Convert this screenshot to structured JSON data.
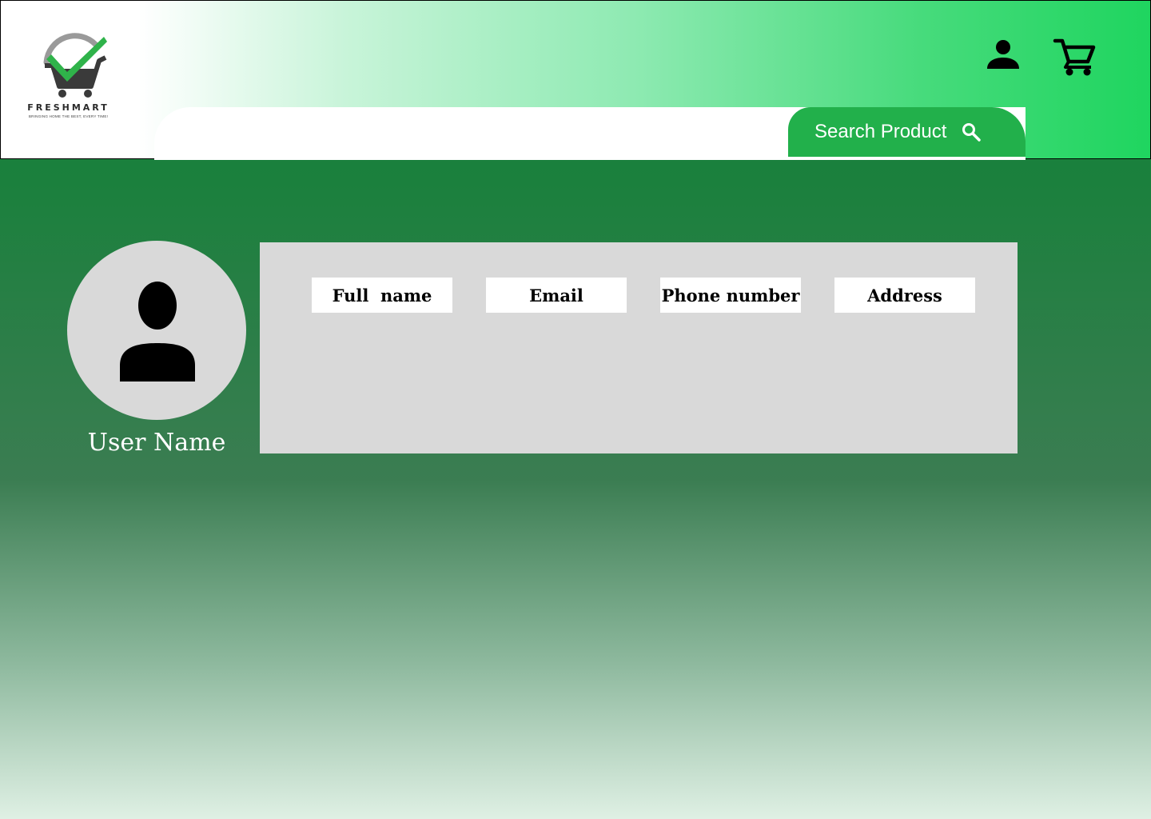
{
  "brand": {
    "name": "FRESHMART",
    "tagline": "BRINGING HOME THE BEST, EVERY TIME!",
    "colors": {
      "primary": "#22b04b",
      "dark": "#157f3b",
      "accent_check": "#2fb34a",
      "cart_gray": "#3a3a3a"
    }
  },
  "header": {
    "search_button_label": "Search Product",
    "icons": [
      "search-icon",
      "user-icon",
      "shopping-cart-icon"
    ]
  },
  "profile": {
    "user_name": "User Name",
    "fields": [
      {
        "label": "Full  name"
      },
      {
        "label": "Email"
      },
      {
        "label": "Phone number"
      },
      {
        "label": "Address"
      }
    ]
  }
}
